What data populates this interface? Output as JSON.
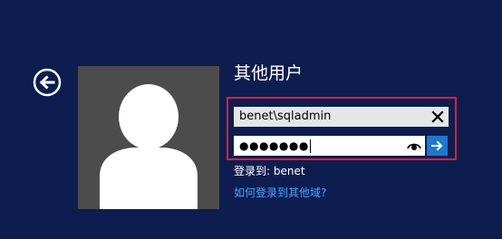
{
  "screen": {
    "title": "其他用户"
  },
  "back_button": {
    "icon": "arrow-left-icon"
  },
  "avatar": {
    "icon": "user-silhouette-icon"
  },
  "form": {
    "username_value": "benet\\sqladmin",
    "clear_icon": "close-icon",
    "password_mask": "●●●●●●●",
    "reveal_icon": "eye-icon",
    "submit_icon": "arrow-right-icon"
  },
  "sign_in_to": {
    "label": "登录到:",
    "domain": "benet"
  },
  "help_link": {
    "label": "如何登录到其他域?"
  },
  "colors": {
    "background": "#0e1d4f",
    "highlight_border": "#d4223a",
    "submit_button": "#1f78c9",
    "link": "#4aa3ff"
  }
}
